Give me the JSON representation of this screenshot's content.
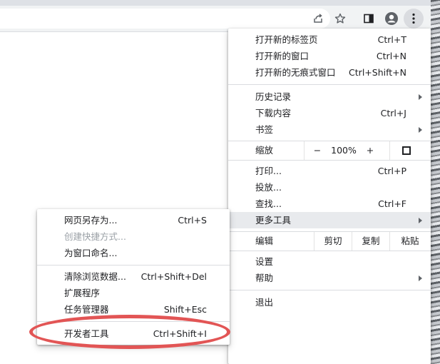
{
  "main_menu": {
    "new_tab": {
      "label": "打开新的标签页",
      "shortcut": "Ctrl+T"
    },
    "new_window": {
      "label": "打开新的窗口",
      "shortcut": "Ctrl+N"
    },
    "new_incognito": {
      "label": "打开新的无痕式窗口",
      "shortcut": "Ctrl+Shift+N"
    },
    "history": {
      "label": "历史记录"
    },
    "downloads": {
      "label": "下载内容",
      "shortcut": "Ctrl+J"
    },
    "bookmarks": {
      "label": "书签"
    },
    "zoom": {
      "label": "缩放",
      "minus": "−",
      "value": "100%",
      "plus": "+"
    },
    "print": {
      "label": "打印...",
      "shortcut": "Ctrl+P"
    },
    "cast": {
      "label": "投放..."
    },
    "find": {
      "label": "查找...",
      "shortcut": "Ctrl+F"
    },
    "more_tools": {
      "label": "更多工具"
    },
    "edit": {
      "label": "编辑",
      "cut": "剪切",
      "copy": "复制",
      "paste": "粘贴"
    },
    "settings": {
      "label": "设置"
    },
    "help": {
      "label": "帮助"
    },
    "exit": {
      "label": "退出"
    }
  },
  "sub_menu": {
    "save_page": {
      "label": "网页另存为...",
      "shortcut": "Ctrl+S"
    },
    "create_shortcut": {
      "label": "创建快捷方式..."
    },
    "name_window": {
      "label": "为窗口命名..."
    },
    "clear_data": {
      "label": "清除浏览数据...",
      "shortcut": "Ctrl+Shift+Del"
    },
    "extensions": {
      "label": "扩展程序"
    },
    "task_manager": {
      "label": "任务管理器",
      "shortcut": "Shift+Esc"
    },
    "dev_tools": {
      "label": "开发者工具",
      "shortcut": "Ctrl+Shift+I"
    }
  },
  "toolbar_icons": [
    "share-icon",
    "bookmark-star-icon",
    "side-panel-icon",
    "profile-icon",
    "kebab-menu-icon"
  ],
  "colors": {
    "annotation": "#e25555",
    "highlight": "#e8eaed"
  }
}
